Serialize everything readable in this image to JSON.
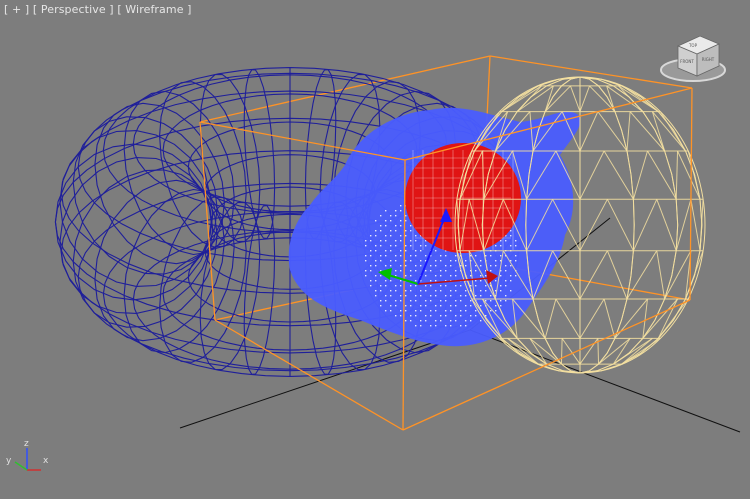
{
  "viewport": {
    "label_parts": [
      "[ + ]",
      "[ Perspective ]",
      "[ Wireframe ]"
    ],
    "background_color": "#7d7d7d"
  },
  "viewcube": {
    "icon": "viewcube-icon",
    "face_top_label": "TOP",
    "face_front_label": "FRONT",
    "face_right_label": "RIGHT"
  },
  "axis_tripod": {
    "x_label": "x",
    "y_label": "y",
    "z_label": "z",
    "colors": {
      "x": "#d23030",
      "y": "#30c030",
      "z": "#3050ff"
    }
  },
  "scene_objects": [
    {
      "name": "torus",
      "color": "#1f1f9a"
    },
    {
      "name": "blob-mesh",
      "color": "#4a5dff"
    },
    {
      "name": "red-sphere",
      "color": "#e01414"
    },
    {
      "name": "geosphere",
      "color": "#f3dfa0"
    },
    {
      "name": "selection-box",
      "color": "#ff9326"
    }
  ]
}
